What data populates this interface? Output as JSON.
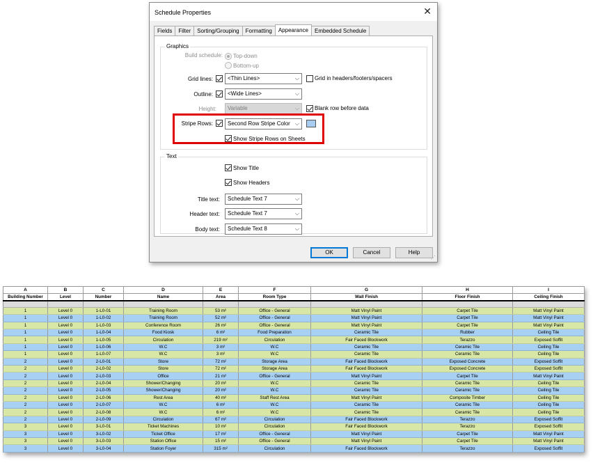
{
  "dialog": {
    "title": "Schedule Properties",
    "close_glyph": "✕",
    "tabs": [
      "Fields",
      "Filter",
      "Sorting/Grouping",
      "Formatting",
      "Appearance",
      "Embedded Schedule"
    ],
    "active_tab": "Appearance",
    "graphics": {
      "group_label": "Graphics",
      "build_schedule_label": "Build schedule:",
      "top_down": "Top-down",
      "bottom_up": "Bottom-up",
      "grid_lines_label": "Grid lines:",
      "grid_lines_value": "<Thin Lines>",
      "grid_in_headers_label": "Grid in headers/footers/spacers",
      "outline_label": "Outline:",
      "outline_value": "<Wide Lines>",
      "height_label": "Height:",
      "height_value": "Variable",
      "blank_row_label": "Blank row before data",
      "stripe_rows_label": "Stripe Rows:",
      "stripe_rows_value": "Second Row Stripe Color",
      "stripe_color": "#a9cdf0",
      "show_stripe_label": "Show Stripe Rows on Sheets"
    },
    "text": {
      "group_label": "Text",
      "show_title_label": "Show Title",
      "show_headers_label": "Show Headers",
      "title_text_label": "Title text:",
      "title_text_value": "Schedule Text 7",
      "header_text_label": "Header text:",
      "header_text_value": "Schedule Text 7",
      "body_text_label": "Body text:",
      "body_text_value": "Schedule Text 8"
    },
    "buttons": {
      "ok": "OK",
      "cancel": "Cancel",
      "help": "Help"
    }
  },
  "schedule": {
    "column_letters": [
      "A",
      "B",
      "C",
      "D",
      "E",
      "F",
      "G",
      "H",
      "I"
    ],
    "headers": [
      "Building Number",
      "Level",
      "Number",
      "Name",
      "Area",
      "Room Type",
      "Wall Finish",
      "Floor Finish",
      "Ceiling Finish"
    ],
    "stripe_colors": {
      "odd": "#d8e7a5",
      "even": "#a8d0f2"
    },
    "rows": [
      [
        "1",
        "Level 0",
        "1-L0-01",
        "Training Room",
        "53 m²",
        "Office - General",
        "Matt Vinyl Paint",
        "Carpet Tile",
        "Matt Vinyl Paint"
      ],
      [
        "1",
        "Level 0",
        "1-L0-02",
        "Training Room",
        "52 m²",
        "Office - General",
        "Matt Vinyl Paint",
        "Carpet Tile",
        "Matt Vinyl Paint"
      ],
      [
        "1",
        "Level 0",
        "1-L0-03",
        "Conference Room",
        "26 m²",
        "Office - General",
        "Matt Vinyl Paint",
        "Carpet Tile",
        "Matt Vinyl Paint"
      ],
      [
        "1",
        "Level 0",
        "1-L0-04",
        "Food Kiosk",
        "6 m²",
        "Food Preparation",
        "Ceramic Tile",
        "Rubber",
        "Ceiling Tile"
      ],
      [
        "1",
        "Level 0",
        "1-L0-05",
        "Circulation",
        "219 m²",
        "Circulation",
        "Fair Faced Blockwork",
        "Terazzo",
        "Exposed Soffit"
      ],
      [
        "1",
        "Level 0",
        "1-L0-06",
        "W.C",
        "3 m²",
        "W.C",
        "Ceramic Tile",
        "Ceramic Tile",
        "Ceiling Tile"
      ],
      [
        "1",
        "Level 0",
        "1-L0-07",
        "W.C",
        "3 m²",
        "W.C",
        "Ceramic Tile",
        "Ceramic Tile",
        "Ceiling Tile"
      ],
      [
        "2",
        "Level 0",
        "2-L0-01",
        "Store",
        "72 m²",
        "Storage Area",
        "Fair Faced Blockwork",
        "Exposed Concrete",
        "Exposed Soffit"
      ],
      [
        "2",
        "Level 0",
        "2-L0-02",
        "Store",
        "72 m²",
        "Storage Area",
        "Fair Faced Blockwork",
        "Exposed Concrete",
        "Exposed Soffit"
      ],
      [
        "2",
        "Level 0",
        "2-L0-03",
        "Office",
        "21 m²",
        "Office - General",
        "Matt Vinyl Paint",
        "Carpet Tile",
        "Matt Vinyl Paint"
      ],
      [
        "2",
        "Level 0",
        "2-L0-04",
        "Shower/Changing",
        "20 m²",
        "W.C",
        "Ceramic Tile",
        "Ceramic Tile",
        "Ceiling Tile"
      ],
      [
        "2",
        "Level 0",
        "2-L0-05",
        "Shower/Changing",
        "20 m²",
        "W.C",
        "Ceramic Tile",
        "Ceramic Tile",
        "Ceiling Tile"
      ],
      [
        "2",
        "Level 0",
        "2-L0-06",
        "Rest Area",
        "40 m²",
        "Staff Rest Area",
        "Matt Vinyl Paint",
        "Composite Timber",
        "Ceiling Tile"
      ],
      [
        "2",
        "Level 0",
        "2-L0-07",
        "W.C",
        "6 m²",
        "W.C",
        "Ceramic Tile",
        "Ceramic Tile",
        "Ceiling Tile"
      ],
      [
        "2",
        "Level 0",
        "2-L0-08",
        "W.C",
        "6 m²",
        "W.C",
        "Ceramic Tile",
        "Ceramic Tile",
        "Ceiling Tile"
      ],
      [
        "2",
        "Level 0",
        "2-L0-09",
        "Circulation",
        "67 m²",
        "Circulation",
        "Fair Faced Blockwork",
        "Terazzo",
        "Exposed Soffit"
      ],
      [
        "3",
        "Level 0",
        "3-L0-01",
        "Ticket Machines",
        "10 m²",
        "Circulation",
        "Fair Faced Blockwork",
        "Terazzo",
        "Exposed Soffit"
      ],
      [
        "3",
        "Level 0",
        "3-L0-02",
        "Ticket Office",
        "17 m²",
        "Office - General",
        "Matt Vinyl Paint",
        "Carpet Tile",
        "Matt Vinyl Paint"
      ],
      [
        "3",
        "Level 0",
        "3-L0-03",
        "Station Office",
        "15 m²",
        "Office - General",
        "Matt Vinyl Paint",
        "Carpet Tile",
        "Matt Vinyl Paint"
      ],
      [
        "3",
        "Level 0",
        "3-L0-04",
        "Station Foyer",
        "315 m²",
        "Circulation",
        "Fair Faced Blockwork",
        "Terazzo",
        "Exposed Soffit"
      ]
    ]
  }
}
